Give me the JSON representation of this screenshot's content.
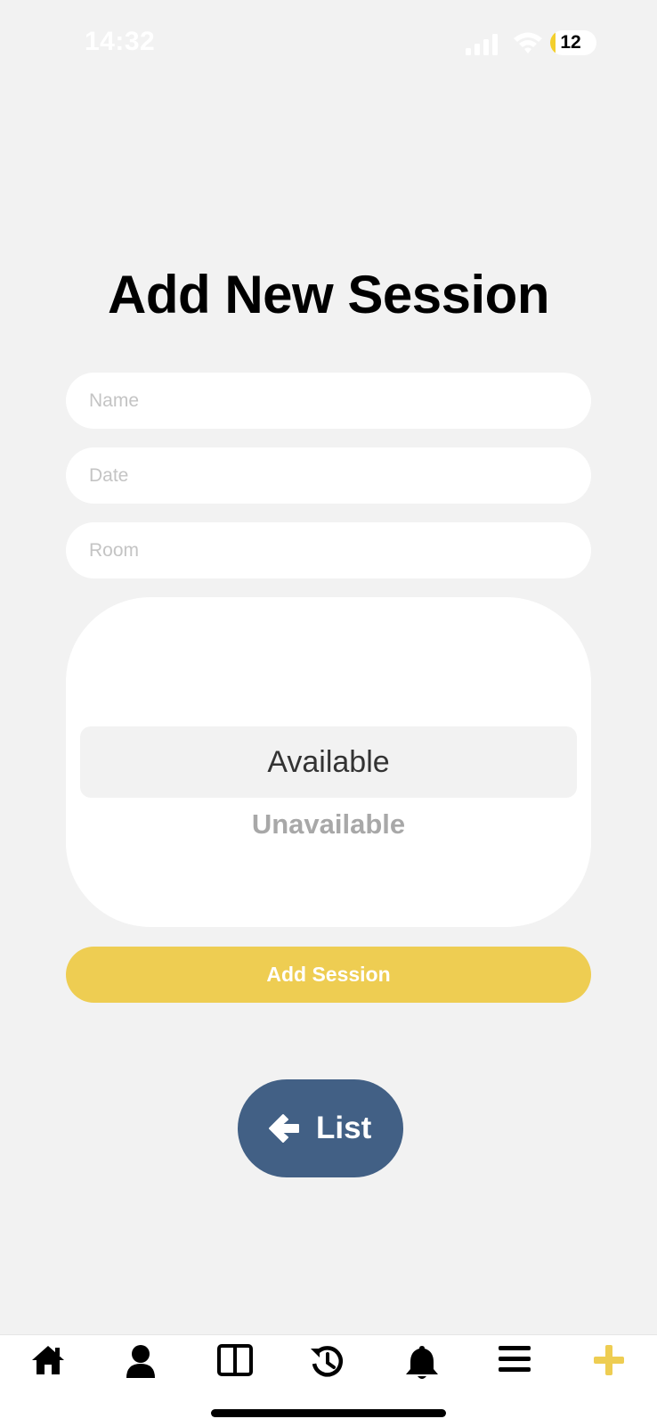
{
  "status_bar": {
    "time": "14:32",
    "battery_level": "12"
  },
  "page": {
    "title": "Add New Session"
  },
  "form": {
    "name_placeholder": "Name",
    "date_placeholder": "Date",
    "room_placeholder": "Room",
    "status_options": [
      "Available",
      "Unavailable"
    ],
    "status_selected": "Available",
    "submit_label": "Add Session"
  },
  "list_button": {
    "label": "List"
  },
  "tab_bar": {
    "items": [
      {
        "icon": "home-icon"
      },
      {
        "icon": "user-icon"
      },
      {
        "icon": "columns-icon"
      },
      {
        "icon": "history-icon"
      },
      {
        "icon": "bell-icon"
      },
      {
        "icon": "menu-icon"
      },
      {
        "icon": "plus-icon",
        "active": true
      }
    ]
  },
  "colors": {
    "accent": "#eecd52",
    "list_button": "#426085",
    "background": "#f2f2f2"
  }
}
